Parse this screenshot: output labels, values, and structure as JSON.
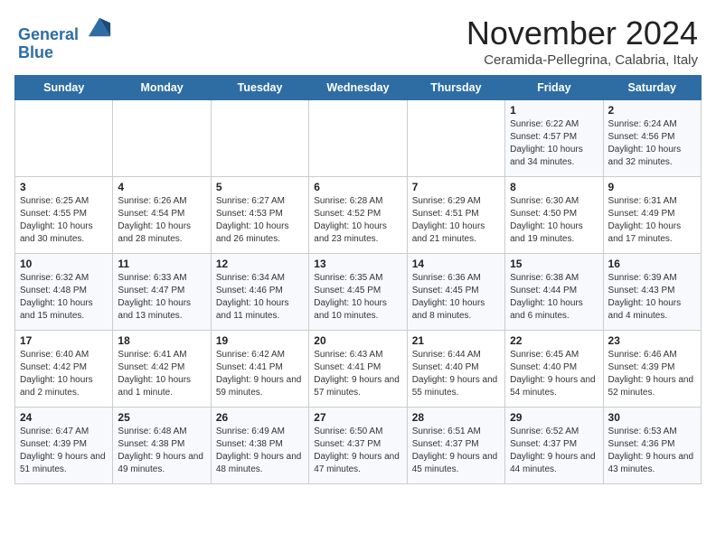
{
  "header": {
    "logo_line1": "General",
    "logo_line2": "Blue",
    "month": "November 2024",
    "location": "Ceramida-Pellegrina, Calabria, Italy"
  },
  "days_of_week": [
    "Sunday",
    "Monday",
    "Tuesday",
    "Wednesday",
    "Thursday",
    "Friday",
    "Saturday"
  ],
  "weeks": [
    [
      {
        "day": "",
        "content": ""
      },
      {
        "day": "",
        "content": ""
      },
      {
        "day": "",
        "content": ""
      },
      {
        "day": "",
        "content": ""
      },
      {
        "day": "",
        "content": ""
      },
      {
        "day": "1",
        "content": "Sunrise: 6:22 AM\nSunset: 4:57 PM\nDaylight: 10 hours and 34 minutes."
      },
      {
        "day": "2",
        "content": "Sunrise: 6:24 AM\nSunset: 4:56 PM\nDaylight: 10 hours and 32 minutes."
      }
    ],
    [
      {
        "day": "3",
        "content": "Sunrise: 6:25 AM\nSunset: 4:55 PM\nDaylight: 10 hours and 30 minutes."
      },
      {
        "day": "4",
        "content": "Sunrise: 6:26 AM\nSunset: 4:54 PM\nDaylight: 10 hours and 28 minutes."
      },
      {
        "day": "5",
        "content": "Sunrise: 6:27 AM\nSunset: 4:53 PM\nDaylight: 10 hours and 26 minutes."
      },
      {
        "day": "6",
        "content": "Sunrise: 6:28 AM\nSunset: 4:52 PM\nDaylight: 10 hours and 23 minutes."
      },
      {
        "day": "7",
        "content": "Sunrise: 6:29 AM\nSunset: 4:51 PM\nDaylight: 10 hours and 21 minutes."
      },
      {
        "day": "8",
        "content": "Sunrise: 6:30 AM\nSunset: 4:50 PM\nDaylight: 10 hours and 19 minutes."
      },
      {
        "day": "9",
        "content": "Sunrise: 6:31 AM\nSunset: 4:49 PM\nDaylight: 10 hours and 17 minutes."
      }
    ],
    [
      {
        "day": "10",
        "content": "Sunrise: 6:32 AM\nSunset: 4:48 PM\nDaylight: 10 hours and 15 minutes."
      },
      {
        "day": "11",
        "content": "Sunrise: 6:33 AM\nSunset: 4:47 PM\nDaylight: 10 hours and 13 minutes."
      },
      {
        "day": "12",
        "content": "Sunrise: 6:34 AM\nSunset: 4:46 PM\nDaylight: 10 hours and 11 minutes."
      },
      {
        "day": "13",
        "content": "Sunrise: 6:35 AM\nSunset: 4:45 PM\nDaylight: 10 hours and 10 minutes."
      },
      {
        "day": "14",
        "content": "Sunrise: 6:36 AM\nSunset: 4:45 PM\nDaylight: 10 hours and 8 minutes."
      },
      {
        "day": "15",
        "content": "Sunrise: 6:38 AM\nSunset: 4:44 PM\nDaylight: 10 hours and 6 minutes."
      },
      {
        "day": "16",
        "content": "Sunrise: 6:39 AM\nSunset: 4:43 PM\nDaylight: 10 hours and 4 minutes."
      }
    ],
    [
      {
        "day": "17",
        "content": "Sunrise: 6:40 AM\nSunset: 4:42 PM\nDaylight: 10 hours and 2 minutes."
      },
      {
        "day": "18",
        "content": "Sunrise: 6:41 AM\nSunset: 4:42 PM\nDaylight: 10 hours and 1 minute."
      },
      {
        "day": "19",
        "content": "Sunrise: 6:42 AM\nSunset: 4:41 PM\nDaylight: 9 hours and 59 minutes."
      },
      {
        "day": "20",
        "content": "Sunrise: 6:43 AM\nSunset: 4:41 PM\nDaylight: 9 hours and 57 minutes."
      },
      {
        "day": "21",
        "content": "Sunrise: 6:44 AM\nSunset: 4:40 PM\nDaylight: 9 hours and 55 minutes."
      },
      {
        "day": "22",
        "content": "Sunrise: 6:45 AM\nSunset: 4:40 PM\nDaylight: 9 hours and 54 minutes."
      },
      {
        "day": "23",
        "content": "Sunrise: 6:46 AM\nSunset: 4:39 PM\nDaylight: 9 hours and 52 minutes."
      }
    ],
    [
      {
        "day": "24",
        "content": "Sunrise: 6:47 AM\nSunset: 4:39 PM\nDaylight: 9 hours and 51 minutes."
      },
      {
        "day": "25",
        "content": "Sunrise: 6:48 AM\nSunset: 4:38 PM\nDaylight: 9 hours and 49 minutes."
      },
      {
        "day": "26",
        "content": "Sunrise: 6:49 AM\nSunset: 4:38 PM\nDaylight: 9 hours and 48 minutes."
      },
      {
        "day": "27",
        "content": "Sunrise: 6:50 AM\nSunset: 4:37 PM\nDaylight: 9 hours and 47 minutes."
      },
      {
        "day": "28",
        "content": "Sunrise: 6:51 AM\nSunset: 4:37 PM\nDaylight: 9 hours and 45 minutes."
      },
      {
        "day": "29",
        "content": "Sunrise: 6:52 AM\nSunset: 4:37 PM\nDaylight: 9 hours and 44 minutes."
      },
      {
        "day": "30",
        "content": "Sunrise: 6:53 AM\nSunset: 4:36 PM\nDaylight: 9 hours and 43 minutes."
      }
    ]
  ]
}
